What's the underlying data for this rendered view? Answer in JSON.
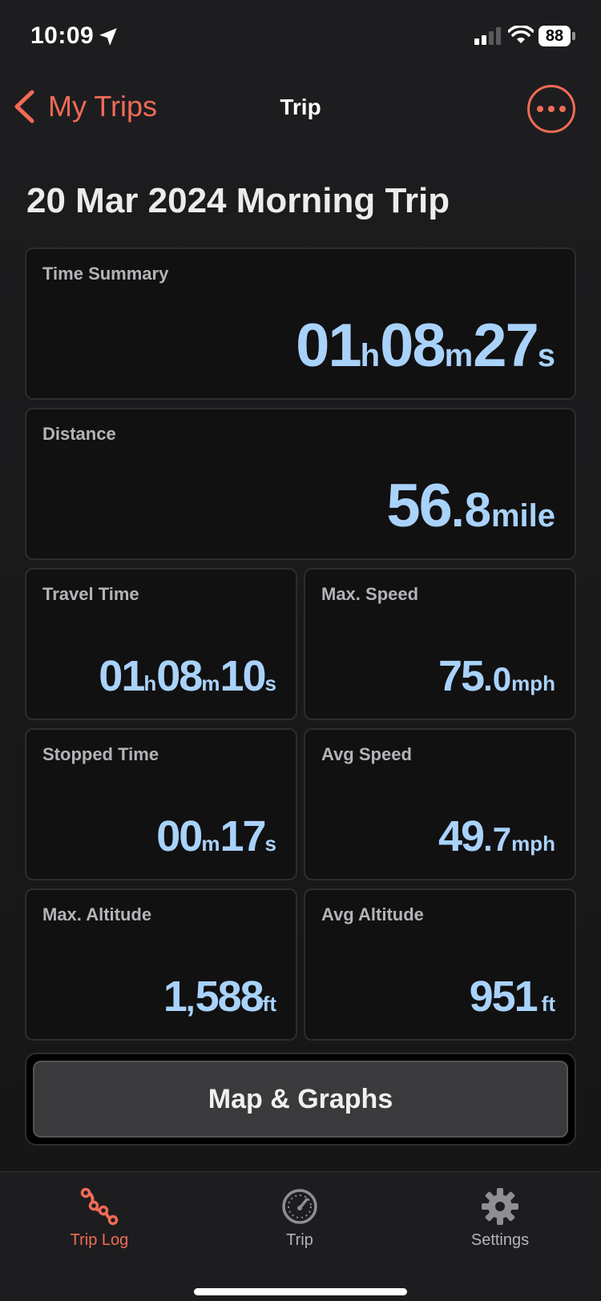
{
  "status_bar": {
    "time": "10:09",
    "battery": "88"
  },
  "nav": {
    "back_label": "My Trips",
    "title": "Trip"
  },
  "trip_title": "20 Mar 2024 Morning Trip",
  "cards": {
    "time_summary": {
      "label": "Time Summary",
      "h": "01",
      "h_unit": "h",
      "m": "08",
      "m_unit": "m",
      "s": "27",
      "s_unit": "s"
    },
    "distance": {
      "label": "Distance",
      "int": "56",
      "dec": ".8",
      "unit": "mile"
    },
    "travel_time": {
      "label": "Travel Time",
      "h": "01",
      "h_unit": "h",
      "m": "08",
      "m_unit": "m",
      "s": "10",
      "s_unit": "s"
    },
    "max_speed": {
      "label": "Max. Speed",
      "int": "75",
      "dec": ".0",
      "unit": "mph"
    },
    "stopped_time": {
      "label": "Stopped Time",
      "m": "00",
      "m_unit": "m",
      "s": "17",
      "s_unit": "s"
    },
    "avg_speed": {
      "label": "Avg Speed",
      "int": "49",
      "dec": ".7",
      "unit": "mph"
    },
    "max_altitude": {
      "label": "Max. Altitude",
      "thousands": "1",
      "sep": ",",
      "rest": "588",
      "unit": "ft"
    },
    "avg_altitude": {
      "label": "Avg Altitude",
      "value": "951",
      "unit": "ft"
    }
  },
  "map_button": "Map & Graphs",
  "tabs": [
    {
      "label": "Trip Log",
      "icon": "route-icon",
      "active": true
    },
    {
      "label": "Trip",
      "icon": "speedometer-icon",
      "active": false
    },
    {
      "label": "Settings",
      "icon": "gear-icon",
      "active": false
    }
  ],
  "colors": {
    "accent": "#f26b55",
    "value": "#a9d2fb",
    "background": "#1c1c1e"
  }
}
